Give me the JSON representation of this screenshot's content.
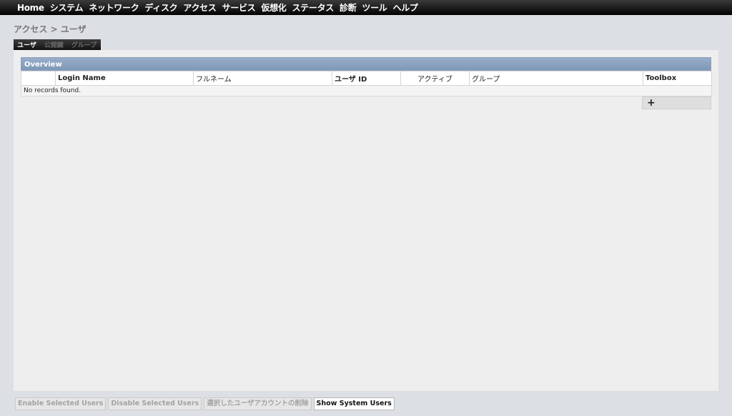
{
  "menu": {
    "items": [
      "Home",
      "システム",
      "ネットワーク",
      "ディスク",
      "アクセス",
      "サービス",
      "仮想化",
      "ステータス",
      "診断",
      "ツール",
      "ヘルプ"
    ]
  },
  "breadcrumb": "アクセス > ユーザ",
  "tabs": [
    "ユーザ",
    "公開鍵",
    "グループ"
  ],
  "overview": {
    "title": "Overview",
    "columns": [
      "",
      "Login Name",
      "フルネーム",
      "ユーザ ID",
      "アクティブ",
      "グループ",
      "Toolbox"
    ],
    "empty_message": "No records found.",
    "add_symbol": "+"
  },
  "bottom_buttons": {
    "enable": "Enable Selected Users",
    "disable": "Disable Selected Users",
    "delete": "選択したユーザアカウントの削除",
    "show_system": "Show System Users"
  },
  "colors": {
    "topbar": "#050505",
    "header_accent": "#8aa0bd",
    "panel_bg": "#eeeeee"
  }
}
